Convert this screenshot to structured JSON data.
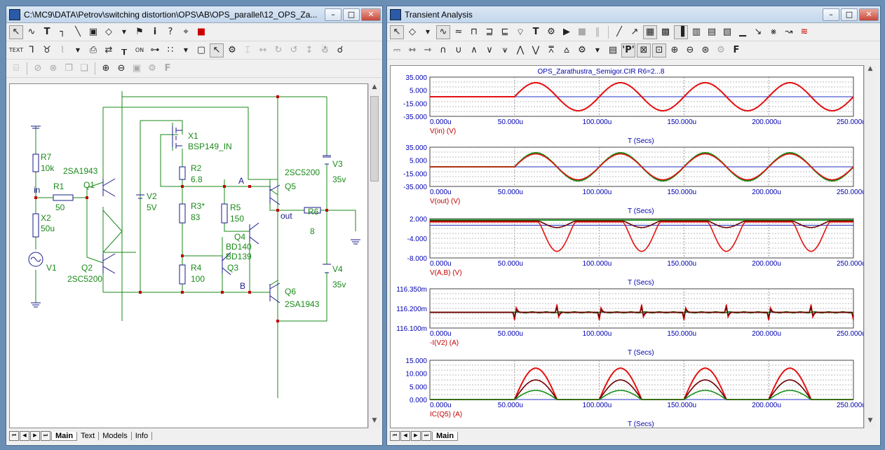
{
  "left_window": {
    "title": "C:\\MC9\\DATA\\Petrov\\switching distortion\\OPS\\AB\\OPS_parallel\\12_OPS_Za...",
    "tabs": [
      "Main",
      "Text",
      "Models",
      "Info"
    ],
    "active_tab": "Main"
  },
  "right_window": {
    "title": "Transient Analysis",
    "tabs": [
      "Main"
    ],
    "active_tab": "Main"
  },
  "schematic": {
    "parts": {
      "R7": {
        "name": "R7",
        "value": "10k"
      },
      "R1": {
        "name": "R1",
        "value": "50"
      },
      "X2": {
        "name": "X2",
        "value": "50u"
      },
      "V1": {
        "name": "V1"
      },
      "Q1": {
        "name": "Q1",
        "model": "2SA1943"
      },
      "Q2": {
        "name": "Q2",
        "model": "2SC5200"
      },
      "V2": {
        "name": "V2",
        "value": "5V"
      },
      "X1": {
        "name": "X1",
        "model": "BSP149_IN"
      },
      "R2": {
        "name": "R2",
        "value": "6.8"
      },
      "R3": {
        "name": "R3*",
        "value": "83"
      },
      "R4": {
        "name": "R4",
        "value": "100"
      },
      "R5": {
        "name": "R5",
        "value": "150"
      },
      "Q3": {
        "name": "Q3",
        "model": "BD139"
      },
      "Q4": {
        "name": "Q4",
        "model": "BD140"
      },
      "Q5": {
        "name": "Q5",
        "model": "2SC5200"
      },
      "Q6": {
        "name": "Q6",
        "model": "2SA1943"
      },
      "R6": {
        "name": "R6",
        "value": "8"
      },
      "V3": {
        "name": "V3",
        "value": "35v"
      },
      "V4": {
        "name": "V4",
        "value": "35v"
      }
    },
    "nodes": {
      "in": "in",
      "out": "out",
      "a": "A",
      "b": "B"
    }
  },
  "plots": {
    "title": "OPS_Zarathustra_Semigor.CIR R6=2...8",
    "x_label": "T (Secs)",
    "x_ticks": [
      "0.000u",
      "50.000u",
      "100.000u",
      "150.000u",
      "200.000u",
      "250.000u"
    ],
    "panels": [
      {
        "y_ticks": [
          "35.000",
          "5.000",
          "-15.000",
          "-35.000"
        ],
        "ylabel": "V(in) (V)"
      },
      {
        "y_ticks": [
          "35.000",
          "5.000",
          "-15.000",
          "-35.000"
        ],
        "ylabel": "V(out) (V)"
      },
      {
        "y_ticks": [
          "2.000",
          "-4.000",
          "-8.000"
        ],
        "ylabel": "V(A,B) (V)"
      },
      {
        "y_ticks": [
          "116.350m",
          "116.200m",
          "116.100m"
        ],
        "ylabel": "-I(V2) (A)"
      },
      {
        "y_ticks": [
          "15.000",
          "10.000",
          "5.000",
          "0.000"
        ],
        "ylabel": "IC(Q5) (A)"
      }
    ]
  },
  "chart_data": [
    {
      "type": "line",
      "ylabel": "V(in) (V)",
      "xlabel": "T (Secs)",
      "xlim": [
        0,
        250
      ],
      "ylim": [
        -35,
        35
      ],
      "series": [
        {
          "color": "#e41010",
          "signal": "0 until 50u, then 25 V sine, period 50u",
          "amplitude": 25,
          "start": 50,
          "period": 50
        }
      ]
    },
    {
      "type": "line",
      "ylabel": "V(out) (V)",
      "xlabel": "T (Secs)",
      "xlim": [
        0,
        250
      ],
      "ylim": [
        -35,
        35
      ],
      "series": [
        {
          "color": "#18901a",
          "amplitude": 25
        },
        {
          "color": "#e41010",
          "amplitude": 23
        }
      ]
    },
    {
      "type": "line",
      "ylabel": "V(A,B) (V)",
      "xlabel": "T (Secs)",
      "xlim": [
        0,
        250
      ],
      "ylim": [
        -10,
        2
      ],
      "series": [
        {
          "color": "#18901a",
          "dip": 0
        },
        {
          "color": "#6b0000",
          "dip": -2
        },
        {
          "color": "#e41010",
          "dip": -9
        }
      ]
    },
    {
      "type": "line",
      "ylabel": "-I(V2) (A)",
      "xlabel": "T (Secs)",
      "xlim": [
        0,
        250
      ],
      "ylim": [
        116.1,
        116.35
      ],
      "y_unit": "mA",
      "series": [
        {
          "color": "#18901a",
          "level": 116.2
        },
        {
          "color": "#e41010"
        },
        {
          "color": "#6b0000"
        }
      ]
    },
    {
      "type": "line",
      "ylabel": "IC(Q5) (A)",
      "xlabel": "T (Secs)",
      "xlim": [
        0,
        250
      ],
      "ylim": [
        0,
        15
      ],
      "series": [
        {
          "color": "#e41010",
          "peak": 12
        },
        {
          "color": "#6b0000",
          "peak": 7.5
        },
        {
          "color": "#18901a",
          "peak": 3.5
        }
      ]
    }
  ],
  "colors": {
    "red": "#e41010",
    "dark_red": "#6b0000",
    "green": "#18901a",
    "axis_text": "#0000b0",
    "grid": "#888888"
  }
}
